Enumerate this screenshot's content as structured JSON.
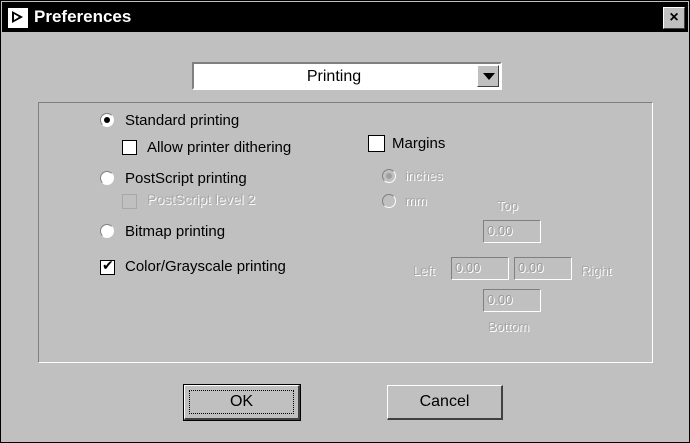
{
  "window": {
    "title": "Preferences",
    "close_label": "×"
  },
  "category": {
    "selected": "Printing"
  },
  "printing": {
    "standard": {
      "label": "Standard printing",
      "checked": true
    },
    "allow_dithering": {
      "label": "Allow printer dithering",
      "checked": false
    },
    "postscript": {
      "label": "PostScript printing",
      "checked": false
    },
    "postscript_level2": {
      "label": "PostScript level 2",
      "checked": false,
      "enabled": false
    },
    "bitmap": {
      "label": "Bitmap printing",
      "checked": false
    },
    "color_grayscale": {
      "label": "Color/Grayscale printing",
      "checked": true
    }
  },
  "margins": {
    "label": "Margins",
    "checked": false,
    "units": {
      "inches": "inches",
      "mm": "mm"
    },
    "top_label": "Top",
    "left_label": "Left",
    "right_label": "Right",
    "bottom_label": "Bottom",
    "top": "0.00",
    "left": "0.00",
    "right": "0.00",
    "bottom": "0.00"
  },
  "buttons": {
    "ok": "OK",
    "cancel": "Cancel"
  }
}
